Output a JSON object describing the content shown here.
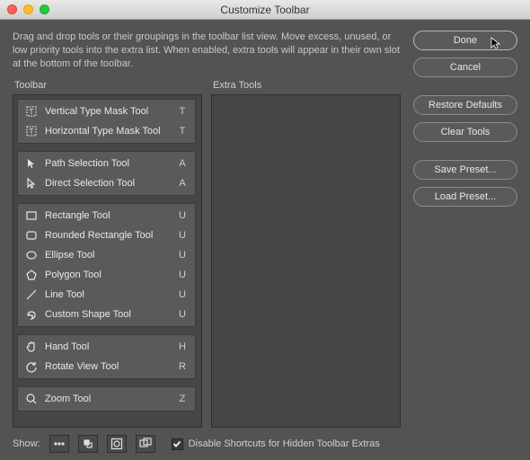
{
  "window": {
    "title": "Customize Toolbar"
  },
  "description": "Drag and drop tools or their groupings in the toolbar list view. Move excess, unused, or low priority tools into the extra list. When enabled, extra tools will appear in their own slot at the bottom of the toolbar.",
  "headers": {
    "toolbar": "Toolbar",
    "extra": "Extra Tools"
  },
  "groups": [
    {
      "tools": [
        {
          "icon": "type-mask-vert",
          "label": "Vertical Type Mask Tool",
          "key": "T"
        },
        {
          "icon": "type-mask",
          "label": "Horizontal Type Mask Tool",
          "key": "T"
        }
      ]
    },
    {
      "tools": [
        {
          "icon": "arrow-solid",
          "label": "Path Selection Tool",
          "key": "A"
        },
        {
          "icon": "arrow-outline",
          "label": "Direct Selection Tool",
          "key": "A"
        }
      ]
    },
    {
      "tools": [
        {
          "icon": "rect",
          "label": "Rectangle Tool",
          "key": "U"
        },
        {
          "icon": "round-rect",
          "label": "Rounded Rectangle Tool",
          "key": "U"
        },
        {
          "icon": "ellipse",
          "label": "Ellipse Tool",
          "key": "U"
        },
        {
          "icon": "polygon",
          "label": "Polygon Tool",
          "key": "U"
        },
        {
          "icon": "line",
          "label": "Line Tool",
          "key": "U"
        },
        {
          "icon": "custom-shape",
          "label": "Custom Shape Tool",
          "key": "U"
        }
      ]
    },
    {
      "tools": [
        {
          "icon": "hand",
          "label": "Hand Tool",
          "key": "H"
        },
        {
          "icon": "rotate",
          "label": "Rotate View Tool",
          "key": "R"
        }
      ]
    },
    {
      "tools": [
        {
          "icon": "zoom",
          "label": "Zoom Tool",
          "key": "Z"
        }
      ]
    }
  ],
  "buttons": {
    "done": "Done",
    "cancel": "Cancel",
    "restore": "Restore Defaults",
    "clear": "Clear Tools",
    "save": "Save Preset...",
    "load": "Load Preset..."
  },
  "footer": {
    "show": "Show:",
    "disable": "Disable Shortcuts for Hidden Toolbar Extras",
    "checked": true
  }
}
